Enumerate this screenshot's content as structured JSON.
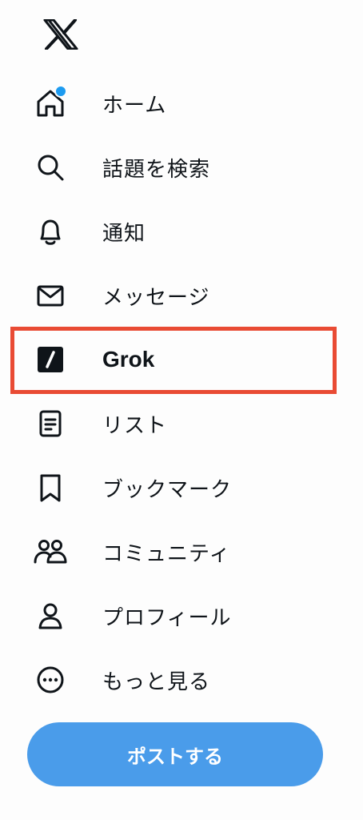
{
  "logo": {
    "icon": "x-logo-icon"
  },
  "nav": {
    "items": [
      {
        "label": "ホーム",
        "icon": "home-icon"
      },
      {
        "label": "話題を検索",
        "icon": "search-icon"
      },
      {
        "label": "通知",
        "icon": "bell-icon"
      },
      {
        "label": "メッセージ",
        "icon": "envelope-icon"
      },
      {
        "label": "Grok",
        "icon": "grok-icon"
      },
      {
        "label": "リスト",
        "icon": "list-icon"
      },
      {
        "label": "ブックマーク",
        "icon": "bookmark-icon"
      },
      {
        "label": "コミュニティ",
        "icon": "communities-icon"
      },
      {
        "label": "プロフィール",
        "icon": "profile-icon"
      },
      {
        "label": "もっと見る",
        "icon": "more-icon"
      }
    ]
  },
  "post_button": {
    "label": "ポストする"
  },
  "colors": {
    "accent": "#4a9cea",
    "notification_dot": "#1d9bf0",
    "highlight_border": "#e94b34",
    "text": "#0f1419"
  }
}
